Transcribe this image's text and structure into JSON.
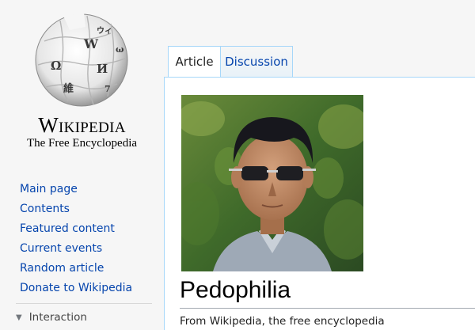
{
  "logo": {
    "wordmark": "Wikipedia",
    "tagline": "The Free Encyclopedia",
    "glyphs": [
      "W",
      "Ω",
      "И",
      "ウィ",
      "維",
      "ω",
      "7"
    ]
  },
  "sidebar": {
    "items": [
      {
        "label": "Main page"
      },
      {
        "label": "Contents"
      },
      {
        "label": "Featured content"
      },
      {
        "label": "Current events"
      },
      {
        "label": "Random article"
      },
      {
        "label": "Donate to Wikipedia"
      }
    ],
    "interaction": {
      "label": "Interaction",
      "icon": "triangle-down-icon"
    }
  },
  "tabs": [
    {
      "label": "Article",
      "active": true
    },
    {
      "label": "Discussion",
      "active": false
    }
  ],
  "article": {
    "title": "Pedophilia",
    "site_sub": "From Wikipedia, the free encyclopedia"
  },
  "colors": {
    "link": "#0645ad",
    "tab_border": "#a7d7f9",
    "sidebar_bg": "#f6f6f6"
  }
}
